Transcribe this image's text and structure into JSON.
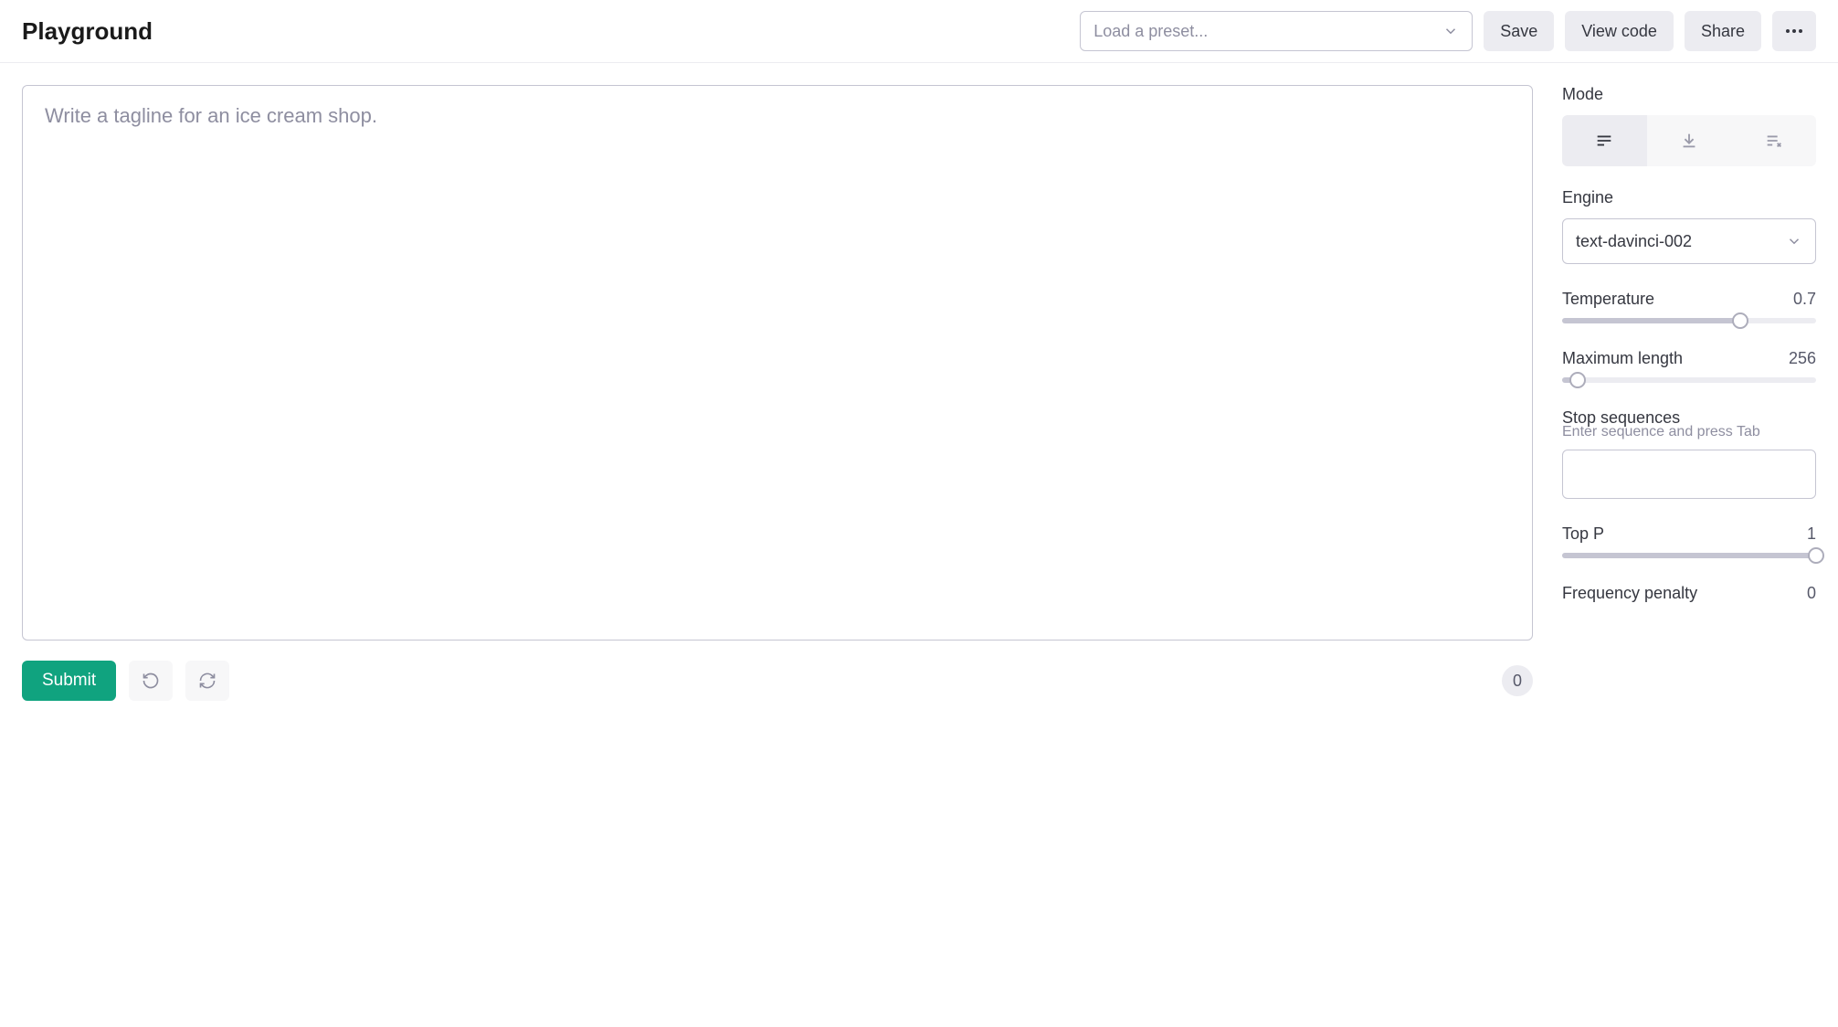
{
  "header": {
    "title": "Playground",
    "preset_placeholder": "Load a preset...",
    "save_label": "Save",
    "view_code_label": "View code",
    "share_label": "Share"
  },
  "editor": {
    "placeholder": "Write a tagline for an ice cream shop.",
    "submit_label": "Submit",
    "token_count": "0"
  },
  "sidebar": {
    "mode_label": "Mode",
    "engine_label": "Engine",
    "engine_value": "text-davinci-002",
    "temperature_label": "Temperature",
    "temperature_value": "0.7",
    "temperature_pct": 70,
    "max_length_label": "Maximum length",
    "max_length_value": "256",
    "max_length_pct": 6,
    "stop_label": "Stop sequences",
    "stop_helper": "Enter sequence and press Tab",
    "top_p_label": "Top P",
    "top_p_value": "1",
    "top_p_pct": 100,
    "freq_penalty_label": "Frequency penalty",
    "freq_penalty_value": "0"
  }
}
